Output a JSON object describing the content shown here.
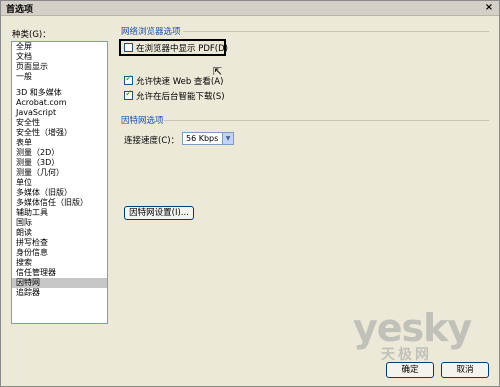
{
  "window": {
    "title": "首选项",
    "close_glyph": "×"
  },
  "categories": {
    "label": "种类(G)：",
    "group1": [
      "全屏",
      "文档",
      "页面显示",
      "一般"
    ],
    "group2": [
      "3D 和多媒体",
      "Acrobat.com",
      "JavaScript",
      "安全性",
      "安全性（增强）",
      "表单",
      "测量（2D）",
      "测量（3D）",
      "测量（几何）",
      "单位",
      "多媒体（旧版）",
      "多媒体信任（旧版）",
      "辅助工具",
      "国际",
      "朗读",
      "拼写检查",
      "身份信息",
      "搜索",
      "信任管理器",
      "因特网",
      "追踪器"
    ],
    "selected": "因特网"
  },
  "browser_options": {
    "title": "网络浏览器选项",
    "show_in_browser": {
      "label": "在浏览器中显示 PDF(D)",
      "checked": false
    },
    "fast_web_view": {
      "label": "允许快速 Web 查看(A)",
      "checked": true
    },
    "background_download": {
      "label": "允许在后台智能下载(S)",
      "checked": true
    }
  },
  "internet_options": {
    "title": "因特网选项",
    "connection_speed_label": "连接速度(C)：",
    "connection_speed_value": "56 Kbps",
    "settings_button": "因特网设置(I)..."
  },
  "buttons": {
    "ok": "确定",
    "cancel": "取消"
  },
  "watermark": {
    "logo": "yesky",
    "sub": "天极网"
  }
}
